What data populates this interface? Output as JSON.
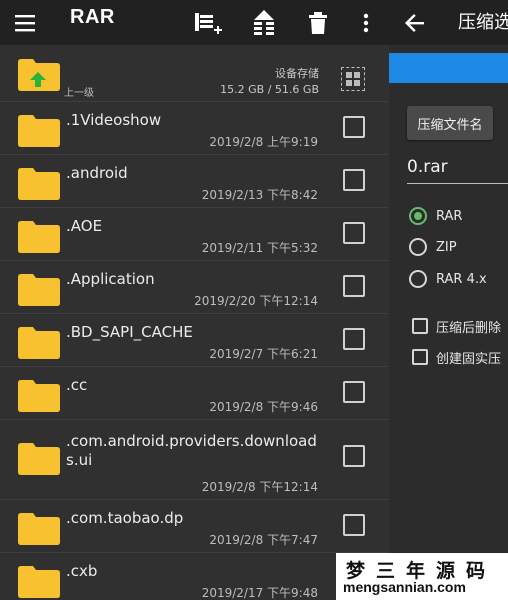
{
  "left_panel": {
    "app_title": "RAR",
    "parent": {
      "label": "上一级",
      "storage_label": "设备存储",
      "storage_size": "15.2 GB / 51.6 GB"
    },
    "files": [
      {
        "name": ".1Videoshow",
        "date": "2019/2/8 上午9:19"
      },
      {
        "name": ".android",
        "date": "2019/2/13 下午8:42"
      },
      {
        "name": ".AOE",
        "date": "2019/2/11 下午5:32"
      },
      {
        "name": ".Application",
        "date": "2019/2/20 下午12:14"
      },
      {
        "name": ".BD_SAPI_CACHE",
        "date": "2019/2/7 下午6:21"
      },
      {
        "name": ".cc",
        "date": "2019/2/8 下午9:46"
      },
      {
        "name": ".com.android.providers.downloads.ui",
        "date": "2019/2/8 下午12:14"
      },
      {
        "name": ".com.taobao.dp",
        "date": "2019/2/8 下午7:47"
      },
      {
        "name": ".cxb",
        "date": "2019/2/17 下午9:48"
      }
    ]
  },
  "right_panel": {
    "title": "压缩选",
    "archive_name_button": "压缩文件名",
    "archive_name_value": "0.rar",
    "formats": [
      {
        "label": "RAR",
        "checked": true
      },
      {
        "label": "ZIP",
        "checked": false
      },
      {
        "label": "RAR 4.x",
        "checked": false
      }
    ],
    "options": [
      {
        "label": "压缩后删除",
        "checked": false
      },
      {
        "label": "创建固实压",
        "checked": false
      }
    ]
  },
  "watermark": {
    "chinese": "梦三年源码",
    "url": "mengsannian.com"
  },
  "colors": {
    "appbar": "#212121",
    "background": "#303030",
    "folder": "#f7c12f",
    "accent_blue": "#1e88e5",
    "radio_green": "#66bb6a"
  }
}
